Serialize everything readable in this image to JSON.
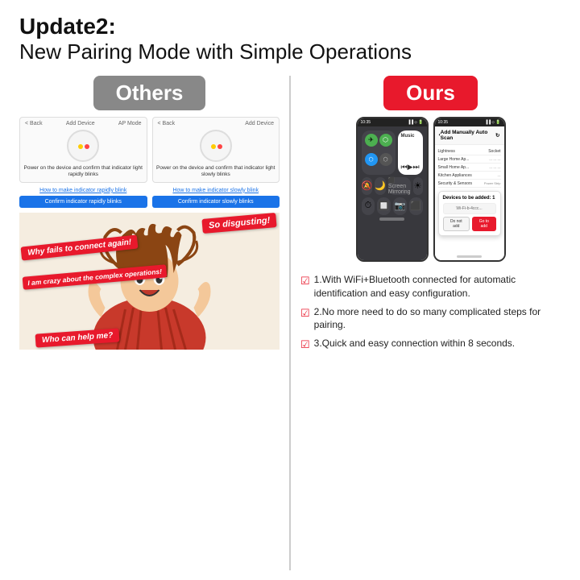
{
  "title": {
    "line1": "Update2:",
    "line2": "New Pairing Mode with Simple Operations"
  },
  "left": {
    "badge": "Others",
    "device1": {
      "header_left": "< Back",
      "header_center": "Add Device",
      "header_right": "AP Mode",
      "caption": "Power on the device and confirm\nthat indicator light rapidly blinks"
    },
    "device2": {
      "header_left": "< Back",
      "header_center": "Add Device",
      "caption": "Power on the device and confirm\nthat indicator light slowly blinks"
    },
    "link1": "How to make indicator rapidly blink",
    "link2": "How to make indicator slowly blink",
    "btn1": "Confirm indicator rapidly blinks",
    "btn2": "Confirm indicator slowly blinks",
    "speech1": "So disgusting!",
    "speech2": "Why fails to connect again!",
    "speech3": "I am crazy about the complex operations!",
    "speech4": "Who can help me?"
  },
  "right": {
    "badge": "Ours",
    "phone1": {
      "status": "10:35",
      "type": "control_center"
    },
    "phone2": {
      "type": "add_device",
      "header": "Add Manually  Auto Scan",
      "dialog_title": "Devices to be added: 1",
      "device_name": "Wi-Fi-b-4ccc...",
      "btn_cancel": "Do not add",
      "btn_confirm": "Go to add"
    },
    "benefits": [
      "1.With WiFi+Bluetooth connected for automatic identification and easy configuration.",
      "2.No more need to do so many complicated steps for pairing.",
      "3.Quick and easy connection within 8 seconds."
    ]
  }
}
